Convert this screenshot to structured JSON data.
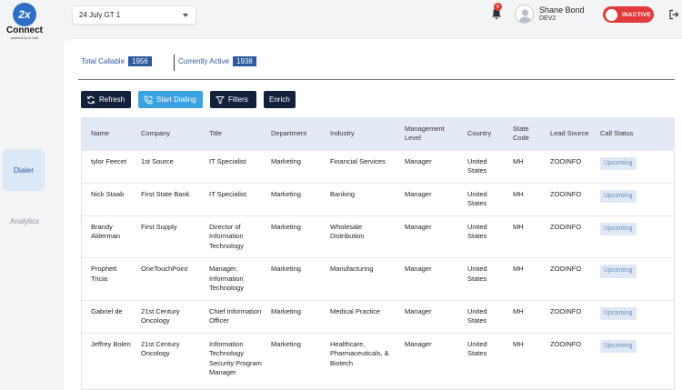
{
  "brand": {
    "badge": "2x",
    "name": "Connect",
    "powered": "powered by ⊛ 1sell"
  },
  "sidebar": {
    "items": [
      {
        "label": "Dialer",
        "active": true
      },
      {
        "label": "Analytics",
        "active": false
      }
    ]
  },
  "header": {
    "list_select": "24 July GT 1",
    "notification_count": "6",
    "user_name": "Shane Bond",
    "user_role": "DEV2",
    "status_toggle": "INACTIVE"
  },
  "stats": {
    "total_callable_label": "Total Callable",
    "total_callable_value": "1956",
    "currently_active_label": "Currently Active",
    "currently_active_value": "1938"
  },
  "toolbar": {
    "refresh": "Refresh",
    "start_dialing": "Start Dialing",
    "filters": "Filters",
    "enrich": "Enrich"
  },
  "table": {
    "columns": [
      "Name",
      "Company",
      "Title",
      "Department",
      "Industry",
      "Management Level",
      "Country",
      "State Code",
      "Lead Source",
      "Call Status"
    ],
    "rows": [
      {
        "name": "tylor Feecet",
        "company": "1st Source",
        "title": "IT Specialist",
        "department": "Marketing",
        "industry": "Financial Services",
        "level": "Manager",
        "country": "United States",
        "state": "MH",
        "source": "ZOOINFO",
        "status": "Upcoming"
      },
      {
        "name": "Nick Staab",
        "company": "First State Bank",
        "title": "IT Specialist",
        "department": "Marketing",
        "industry": "Banking",
        "level": "Manager",
        "country": "United States",
        "state": "MH",
        "source": "ZOOINFO",
        "status": "Upcoming"
      },
      {
        "name": "Brandy Alderman",
        "company": "First Supply",
        "title": "Director of Information Technology",
        "department": "Marketing",
        "industry": "Wholesale Distribution",
        "level": "Manager",
        "country": "United States",
        "state": "MH",
        "source": "ZOOINFO",
        "status": "Upcoming"
      },
      {
        "name": "Prophett Tricia",
        "company": "OneTouchPoint",
        "title": "Manager, Information Technology",
        "department": "Marketing",
        "industry": "Manufacturing",
        "level": "Manager",
        "country": "United States",
        "state": "MH",
        "source": "ZOOINFO",
        "status": "Upcoming"
      },
      {
        "name": "Gabriel de",
        "company": "21st Century Oncology",
        "title": "Chief Information Officer",
        "department": "Marketing",
        "industry": "Medical Practice",
        "level": "Manager",
        "country": "United States",
        "state": "MH",
        "source": "ZOOINFO",
        "status": "Upcoming"
      },
      {
        "name": "Jeffrey Bolen",
        "company": "21st Century Oncology",
        "title": "Information Technology Security Program Manager",
        "department": "Marketing",
        "industry": "Healthcare, Pharmaceuticals, & Biotech",
        "level": "Manager",
        "country": "United States",
        "state": "MH",
        "source": "ZOOINFO",
        "status": "Upcoming"
      }
    ]
  },
  "colors": {
    "accent_dark": "#14213d",
    "accent_blue": "#3aa2e0",
    "badge_blue": "#2d5a9e",
    "inactive_red": "#e23b3b"
  }
}
